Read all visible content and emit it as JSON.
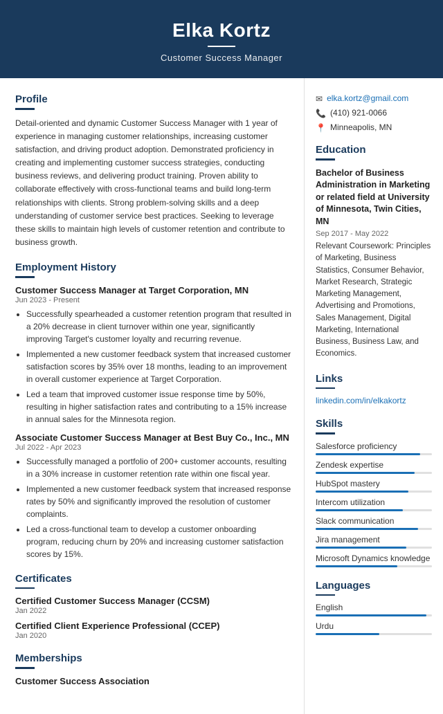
{
  "header": {
    "name": "Elka Kortz",
    "title": "Customer Success Manager",
    "divider": true
  },
  "contact": {
    "email": "elka.kortz@gmail.com",
    "phone": "(410) 921-0066",
    "location": "Minneapolis, MN"
  },
  "profile": {
    "section_title": "Profile",
    "text": "Detail-oriented and dynamic Customer Success Manager with 1 year of experience in managing customer relationships, increasing customer satisfaction, and driving product adoption. Demonstrated proficiency in creating and implementing customer success strategies, conducting business reviews, and delivering product training. Proven ability to collaborate effectively with cross-functional teams and build long-term relationships with clients. Strong problem-solving skills and a deep understanding of customer service best practices. Seeking to leverage these skills to maintain high levels of customer retention and contribute to business growth."
  },
  "employment": {
    "section_title": "Employment History",
    "jobs": [
      {
        "title": "Customer Success Manager at Target Corporation, MN",
        "dates": "Jun 2023 - Present",
        "bullets": [
          "Successfully spearheaded a customer retention program that resulted in a 20% decrease in client turnover within one year, significantly improving Target's customer loyalty and recurring revenue.",
          "Implemented a new customer feedback system that increased customer satisfaction scores by 35% over 18 months, leading to an improvement in overall customer experience at Target Corporation.",
          "Led a team that improved customer issue response time by 50%, resulting in higher satisfaction rates and contributing to a 15% increase in annual sales for the Minnesota region."
        ]
      },
      {
        "title": "Associate Customer Success Manager at Best Buy Co., Inc., MN",
        "dates": "Jul 2022 - Apr 2023",
        "bullets": [
          "Successfully managed a portfolio of 200+ customer accounts, resulting in a 30% increase in customer retention rate within one fiscal year.",
          "Implemented a new customer feedback system that increased response rates by 50% and significantly improved the resolution of customer complaints.",
          "Led a cross-functional team to develop a customer onboarding program, reducing churn by 20% and increasing customer satisfaction scores by 15%."
        ]
      }
    ]
  },
  "certificates": {
    "section_title": "Certificates",
    "items": [
      {
        "title": "Certified Customer Success Manager (CCSM)",
        "date": "Jan 2022"
      },
      {
        "title": "Certified Client Experience Professional (CCEP)",
        "date": "Jan 2020"
      }
    ]
  },
  "memberships": {
    "section_title": "Memberships",
    "items": [
      {
        "name": "Customer Success Association"
      }
    ]
  },
  "education": {
    "section_title": "Education",
    "degree": "Bachelor of Business Administration in Marketing or related field at University of Minnesota, Twin Cities, MN",
    "dates": "Sep 2017 - May 2022",
    "coursework_label": "Relevant Coursework:",
    "coursework": "Principles of Marketing, Business Statistics, Consumer Behavior, Market Research, Strategic Marketing Management, Advertising and Promotions, Sales Management, Digital Marketing, International Business, Business Law, and Economics."
  },
  "links": {
    "section_title": "Links",
    "items": [
      {
        "text": "linkedin.com/in/elkakortz",
        "url": "#"
      }
    ]
  },
  "skills": {
    "section_title": "Skills",
    "items": [
      {
        "name": "Salesforce proficiency",
        "pct": 90
      },
      {
        "name": "Zendesk expertise",
        "pct": 85
      },
      {
        "name": "HubSpot mastery",
        "pct": 80
      },
      {
        "name": "Intercom utilization",
        "pct": 75
      },
      {
        "name": "Slack communication",
        "pct": 88
      },
      {
        "name": "Jira management",
        "pct": 78
      },
      {
        "name": "Microsoft Dynamics knowledge",
        "pct": 70
      }
    ]
  },
  "languages": {
    "section_title": "Languages",
    "items": [
      {
        "name": "English",
        "pct": 95
      },
      {
        "name": "Urdu",
        "pct": 55
      }
    ]
  }
}
